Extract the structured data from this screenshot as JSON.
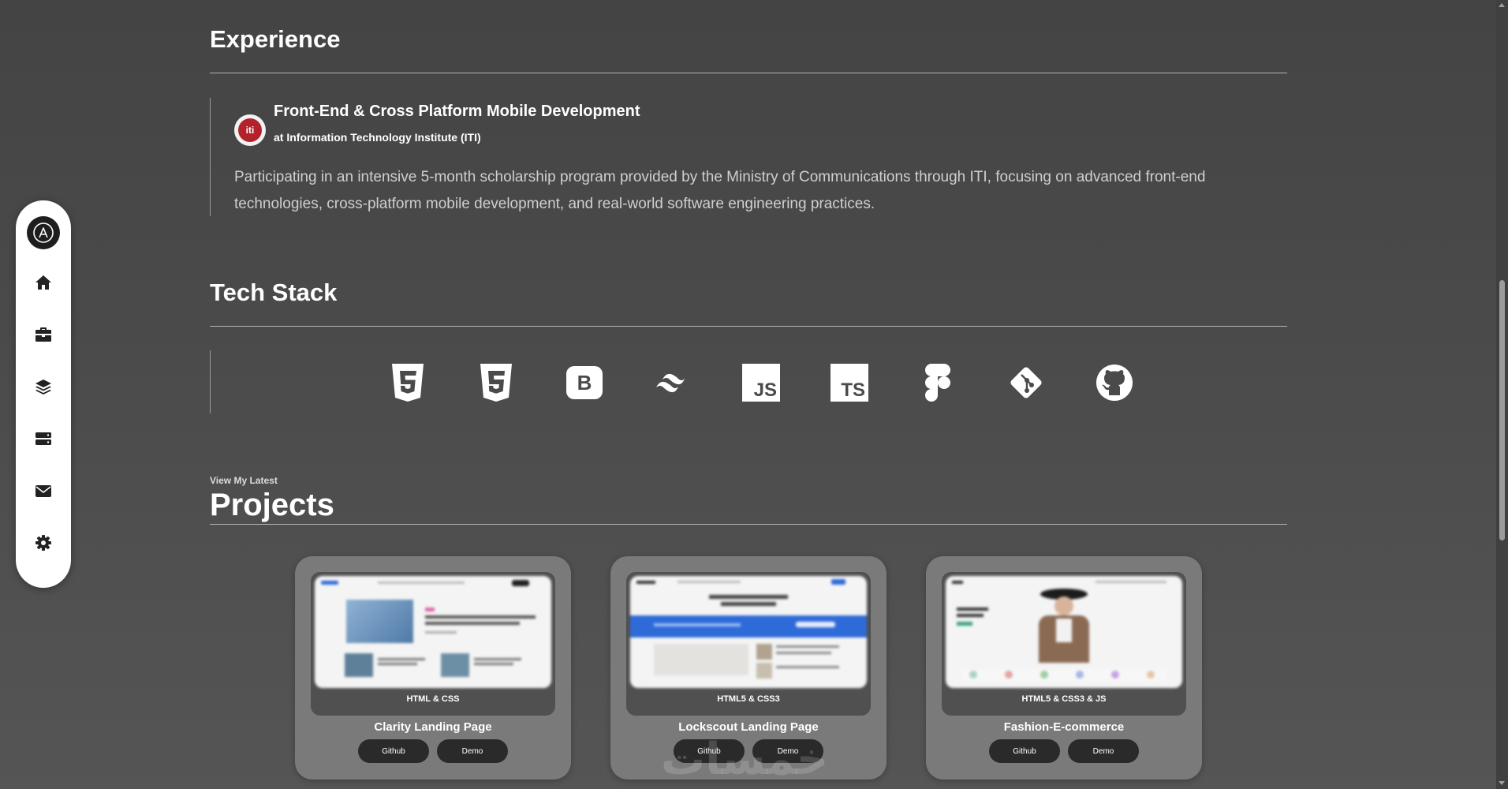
{
  "sidebar": {
    "items": [
      {
        "icon": "home-icon"
      },
      {
        "icon": "briefcase-icon"
      },
      {
        "icon": "layers-icon"
      },
      {
        "icon": "server-icon"
      },
      {
        "icon": "envelope-icon"
      },
      {
        "icon": "gear-icon"
      }
    ]
  },
  "experience": {
    "heading": "Experience",
    "items": [
      {
        "logo_text": "iti",
        "title": "Front-End & Cross Platform Mobile Development",
        "org": "at Information Technology Institute (ITI)",
        "description": "Participating in an intensive 5-month scholarship program provided by the Ministry of Communications through ITI, focusing on advanced front-end technologies, cross-platform mobile development, and real-world software engineering practices."
      }
    ]
  },
  "tech_stack": {
    "heading": "Tech Stack",
    "icons": [
      "html5-icon",
      "css3-icon",
      "bootstrap-icon",
      "tailwind-icon",
      "javascript-icon",
      "typescript-icon",
      "figma-icon",
      "git-icon",
      "github-icon"
    ],
    "labels": {
      "bootstrap": "B",
      "javascript": "JS",
      "typescript": "TS"
    }
  },
  "projects": {
    "eyebrow": "View My Latest",
    "heading": "Projects",
    "items": [
      {
        "name": "Clarity Landing Page",
        "tag": "HTML & CSS",
        "github_label": "Github",
        "demo_label": "Demo"
      },
      {
        "name": "Lockscout Landing Page",
        "tag": "HTML5 & CSS3",
        "github_label": "Github",
        "demo_label": "Demo"
      },
      {
        "name": "Fashion-E-commerce",
        "tag": "HTML5 & CSS3 & JS",
        "github_label": "Github",
        "demo_label": "Demo"
      }
    ]
  },
  "watermark": "خمسات",
  "colors": {
    "background": "#4a4a4a",
    "sidebar": "#ffffff",
    "card": "#7a7a7a",
    "button": "#2a2a2a",
    "iti_red": "#b3212b",
    "lockscout_blue": "#2f6bd8"
  }
}
